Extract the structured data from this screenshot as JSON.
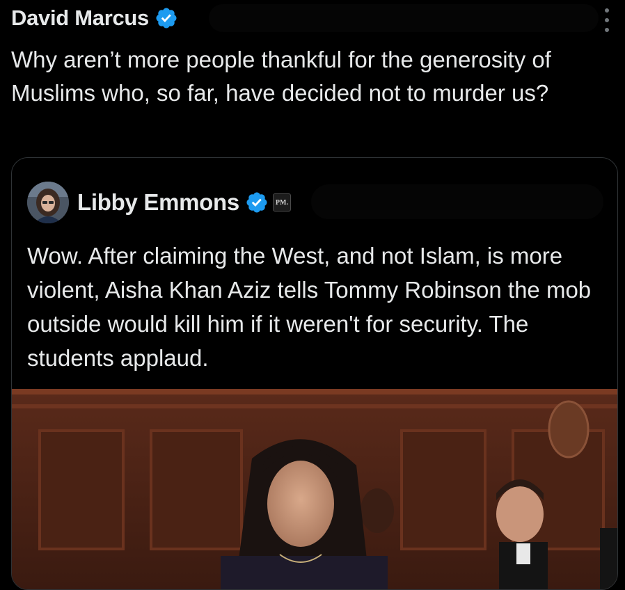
{
  "tweet": {
    "author_name": "David Marcus",
    "text": "Why aren’t more people thankful for the generosity of Muslims who, so far, have decided not to murder us?"
  },
  "quoted_tweet": {
    "author_name": "Libby Emmons",
    "affiliation_badge": "PM.",
    "text": "Wow. After claiming the West, and not Islam, is more violent, Aisha Khan Aziz tells Tommy Robinson the mob outside would kill him if it weren't for security. The students applaud."
  },
  "icons": {
    "verified": "verified-badge-icon",
    "more": "more-options-icon"
  },
  "colors": {
    "background": "#000000",
    "text": "#e7e9ea",
    "verified_blue": "#1d9bf0",
    "border": "#2f3336"
  }
}
